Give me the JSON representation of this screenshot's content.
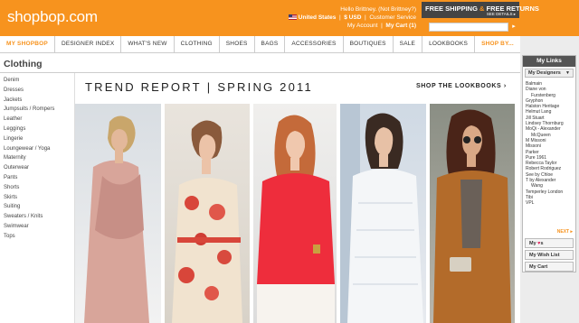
{
  "header": {
    "logo": "shopbop.com",
    "greeting": "Hello Brittney.",
    "not_user": "(Not Brittney?)",
    "country": "United States",
    "currency": "$ USD",
    "customer_service": "Customer Service",
    "my_account": "My Account",
    "my_cart": "My Cart (1)",
    "shipping_title_a": "FREE SHIPPING",
    "shipping_amp": "&",
    "shipping_title_b": "FREE RETURNS",
    "shipping_details": "SEE DETAILS ▸",
    "search_value": "",
    "search_button_glyph": "▸"
  },
  "nav": {
    "items": [
      "MY SHOPBOP",
      "DESIGNER INDEX",
      "WHAT'S NEW",
      "CLOTHING",
      "SHOES",
      "BAGS",
      "ACCESSORIES",
      "BOUTIQUES",
      "SALE",
      "LOOKBOOKS",
      "SHOP BY..."
    ]
  },
  "category": {
    "title": "Clothing",
    "items": [
      "Denim",
      "Dresses",
      "Jackets",
      "Jumpsuits / Rompers",
      "Leather",
      "Leggings",
      "Lingerie",
      "Loungewear / Yoga",
      "Maternity",
      "Outerwear",
      "Pants",
      "Shorts",
      "Skirts",
      "Suiting",
      "Sweaters / Knits",
      "Swimwear",
      "Tops"
    ]
  },
  "banner": {
    "left": "TREND REPORT",
    "sep": "|",
    "right": "SPRING 2011",
    "lookbooks": "SHOP THE LOOKBOOKS ›"
  },
  "photos": [
    "model-blush-drape",
    "model-floral-dress",
    "model-red-blouse",
    "model-white-lace",
    "model-camel-suit"
  ],
  "mylinks": {
    "title": "My Links",
    "designers_tab": "My Designers",
    "designers": [
      "Balmain",
      "Diane von",
      "Furstenberg",
      "Gryphon",
      "Halston Heritage",
      "Helmut Lang",
      "Jill Stuart",
      "Lindsey Thornburg",
      "MoQi - Alexander",
      "McQueen",
      "M Missoni",
      "Missoni",
      "Parker",
      "Pure 1961",
      "Rebecca Taylor",
      "Robert Rodriguez",
      "See by Chloe",
      "T by Alexander",
      "Wang",
      "Temperley London",
      "Tibi",
      "VPL"
    ],
    "indented": [
      2,
      9,
      18
    ],
    "next": "NEXT ▸",
    "my_loves_a": "My",
    "my_loves_heart": "♥",
    "my_loves_b": "s",
    "wish_list": "My Wish List",
    "cart": "My Cart"
  },
  "colors": {
    "brand_orange": "#f7931e",
    "dark_gray": "#444444",
    "heart_pink": "#e0215b"
  }
}
